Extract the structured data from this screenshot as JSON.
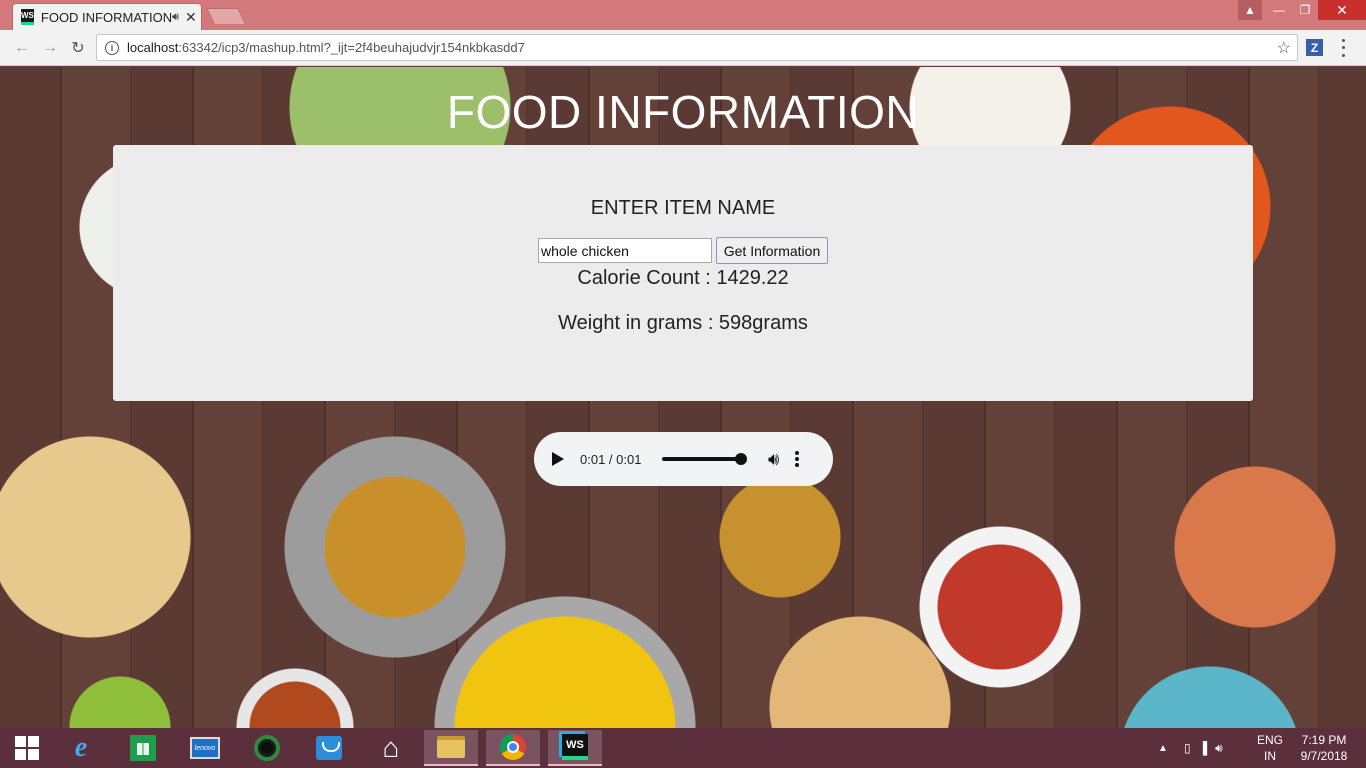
{
  "browser": {
    "tab_title": "FOOD INFORMATION",
    "tab_logo_text": "WS",
    "address": {
      "host": "localhost",
      "rest": ":63342/icp3/mashup.html?_ijt=2f4beuhajudvjr154nkbkasdd7"
    },
    "extension_label": "Z"
  },
  "page": {
    "title": "FOOD INFORMATION",
    "prompt_label": "ENTER ITEM NAME",
    "item_input_value": "whole chicken",
    "button_label": "Get Information",
    "calorie_text": "Calorie Count : 1429.22",
    "weight_text": "Weight in grams : 598grams"
  },
  "audio": {
    "time_text": "0:01 / 0:01",
    "volume_level": 1.0
  },
  "taskbar": {
    "lenovo_label": "lenovo",
    "ws_label": "WS",
    "language_line1": "ENG",
    "language_line2": "IN",
    "time": "7:19 PM",
    "date": "9/7/2018"
  },
  "icons": [
    "ws-logo-icon",
    "speaker-icon",
    "close-icon",
    "back-icon",
    "forward-icon",
    "reload-icon",
    "info-icon",
    "star-icon",
    "menu-icon",
    "play-icon",
    "volume-icon",
    "more-icon",
    "windows-icon",
    "internet-explorer-icon",
    "store-icon",
    "lenovo-icon",
    "circle-app-icon",
    "mail-icon",
    "home-icon",
    "file-explorer-icon",
    "chrome-icon",
    "webstorm-icon",
    "battery-icon",
    "signal-icon"
  ]
}
